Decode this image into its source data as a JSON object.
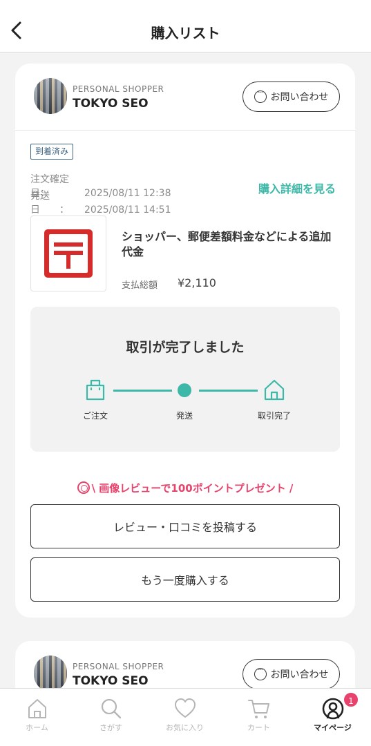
{
  "header": {
    "title": "購入リスト"
  },
  "orders": [
    {
      "shop": {
        "type": "PERSONAL SHOPPER",
        "name": "TOKYO SEO",
        "contact_label": "お問い合わせ"
      },
      "status": "到着済み",
      "order_date_label": "注文確定日：",
      "order_date": "2025/08/11 12:38",
      "ship_date_label": "発送日　　：",
      "ship_date": "2025/08/11 14:51",
      "detail_link": "購入詳細を見る",
      "product": {
        "name": "ショッパー、郵便差額料金などによる追加代金",
        "price_label": "支払総額",
        "price": "¥2,110"
      },
      "progress": {
        "title": "取引が完了しました",
        "steps": [
          "ご注文",
          "発送",
          "取引完了"
        ]
      },
      "promo": "\\ 画像レビューで100ポイントプレゼント /",
      "review_button": "レビュー・口コミを投稿する",
      "rebuy_button": "もう一度購入する"
    },
    {
      "shop": {
        "type": "PERSONAL SHOPPER",
        "name": "TOKYO SEO",
        "contact_label": "お問い合わせ"
      }
    }
  ],
  "tabbar": {
    "items": [
      {
        "label": "ホーム",
        "icon": "home-icon"
      },
      {
        "label": "さがす",
        "icon": "search-icon"
      },
      {
        "label": "お気に入り",
        "icon": "heart-icon"
      },
      {
        "label": "カート",
        "icon": "cart-icon"
      },
      {
        "label": "マイページ",
        "icon": "user-icon",
        "active": true
      }
    ],
    "mypage_badge": "1"
  },
  "colors": {
    "accent": "#3bb8a8",
    "promo": "#e8436c",
    "badge": "#e8436c",
    "status": "#3e6280"
  }
}
